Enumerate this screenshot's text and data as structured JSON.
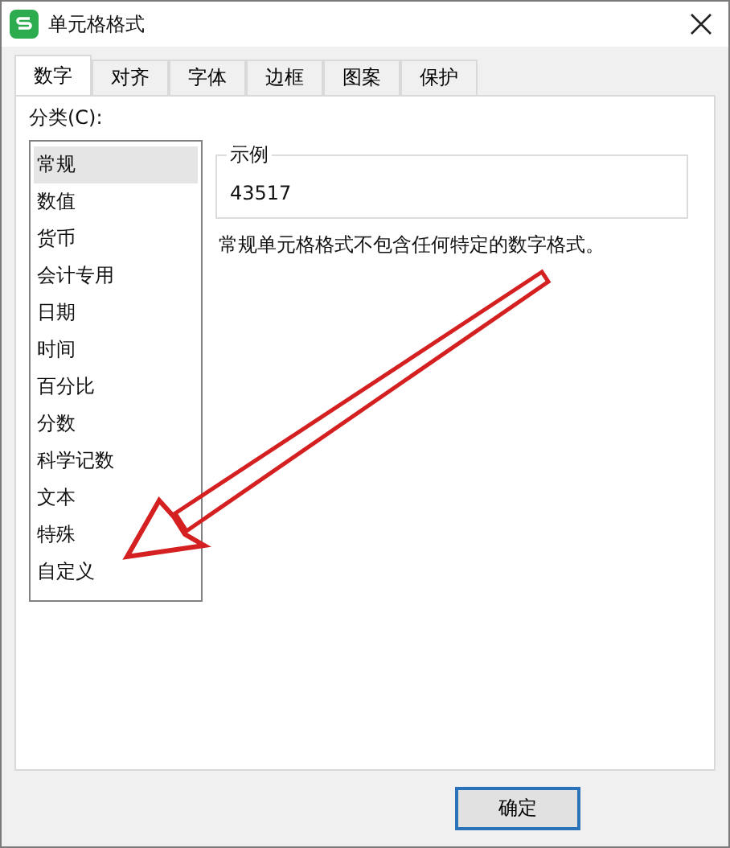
{
  "window": {
    "title": "单元格格式"
  },
  "tabs": [
    {
      "label": "数字",
      "selected": true
    },
    {
      "label": "对齐",
      "selected": false
    },
    {
      "label": "字体",
      "selected": false
    },
    {
      "label": "边框",
      "selected": false
    },
    {
      "label": "图案",
      "selected": false
    },
    {
      "label": "保护",
      "selected": false
    }
  ],
  "category": {
    "label": "分类(C):",
    "items": [
      {
        "label": "常规",
        "selected": true
      },
      {
        "label": "数值",
        "selected": false
      },
      {
        "label": "货币",
        "selected": false
      },
      {
        "label": "会计专用",
        "selected": false
      },
      {
        "label": "日期",
        "selected": false
      },
      {
        "label": "时间",
        "selected": false
      },
      {
        "label": "百分比",
        "selected": false
      },
      {
        "label": "分数",
        "selected": false
      },
      {
        "label": "科学记数",
        "selected": false
      },
      {
        "label": "文本",
        "selected": false
      },
      {
        "label": "特殊",
        "selected": false
      },
      {
        "label": "自定义",
        "selected": false
      }
    ]
  },
  "sample": {
    "label": "示例",
    "value": "43517"
  },
  "description": "常规单元格格式不包含任何特定的数字格式。",
  "buttons": [
    "确定"
  ]
}
